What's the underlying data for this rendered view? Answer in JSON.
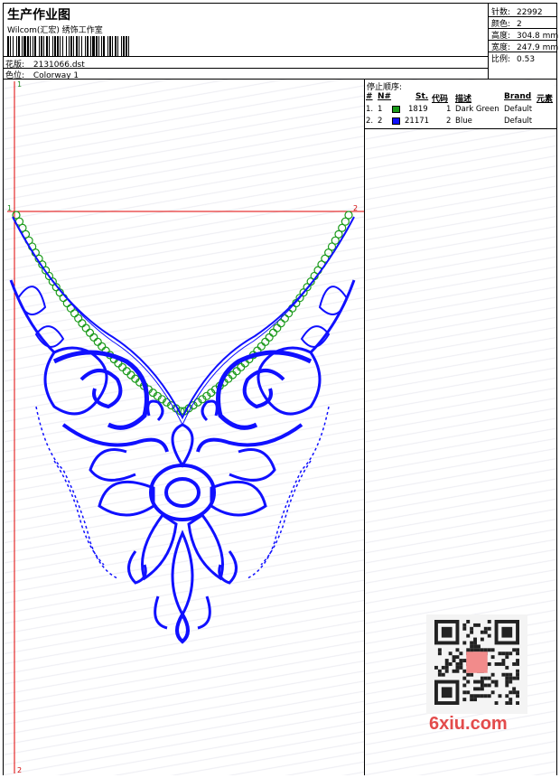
{
  "header": {
    "title": "生产作业图",
    "company": "Wilcom(汇宏) 绣饰工作室",
    "design_label": "花版:",
    "design_value": "2131066.dst",
    "colorway_label": "色位:",
    "colorway_value": "Colorway 1"
  },
  "stats": [
    {
      "label": "针数:",
      "value": "22992"
    },
    {
      "label": "颜色:",
      "value": "2"
    },
    {
      "label": "高度:",
      "value": "304.8 mm"
    },
    {
      "label": "宽度:",
      "value": "247.9 mm"
    },
    {
      "label": "比例:",
      "value": "0.53"
    }
  ],
  "stop_sequence": {
    "title": "停止顺序:",
    "columns": [
      "#",
      "N#",
      "St.",
      "代码",
      "描述",
      "Brand",
      "元素"
    ],
    "rows": [
      {
        "num": "1.",
        "n": "1",
        "color": "#1a9a1a",
        "stitches": "1819",
        "code": "1",
        "desc": "Dark Green",
        "brand": "Default"
      },
      {
        "num": "2.",
        "n": "2",
        "color": "#1010ff",
        "stitches": "21171",
        "code": "2",
        "desc": "Blue",
        "brand": "Default"
      }
    ]
  },
  "markers": {
    "top_green": "1",
    "left_green": "1",
    "right_red": "2",
    "bottom_red": "2"
  },
  "colors": {
    "green": "#1a9a1a",
    "blue": "#1010ff",
    "guide_red": "#e00000"
  },
  "watermark": "6xiu.com"
}
